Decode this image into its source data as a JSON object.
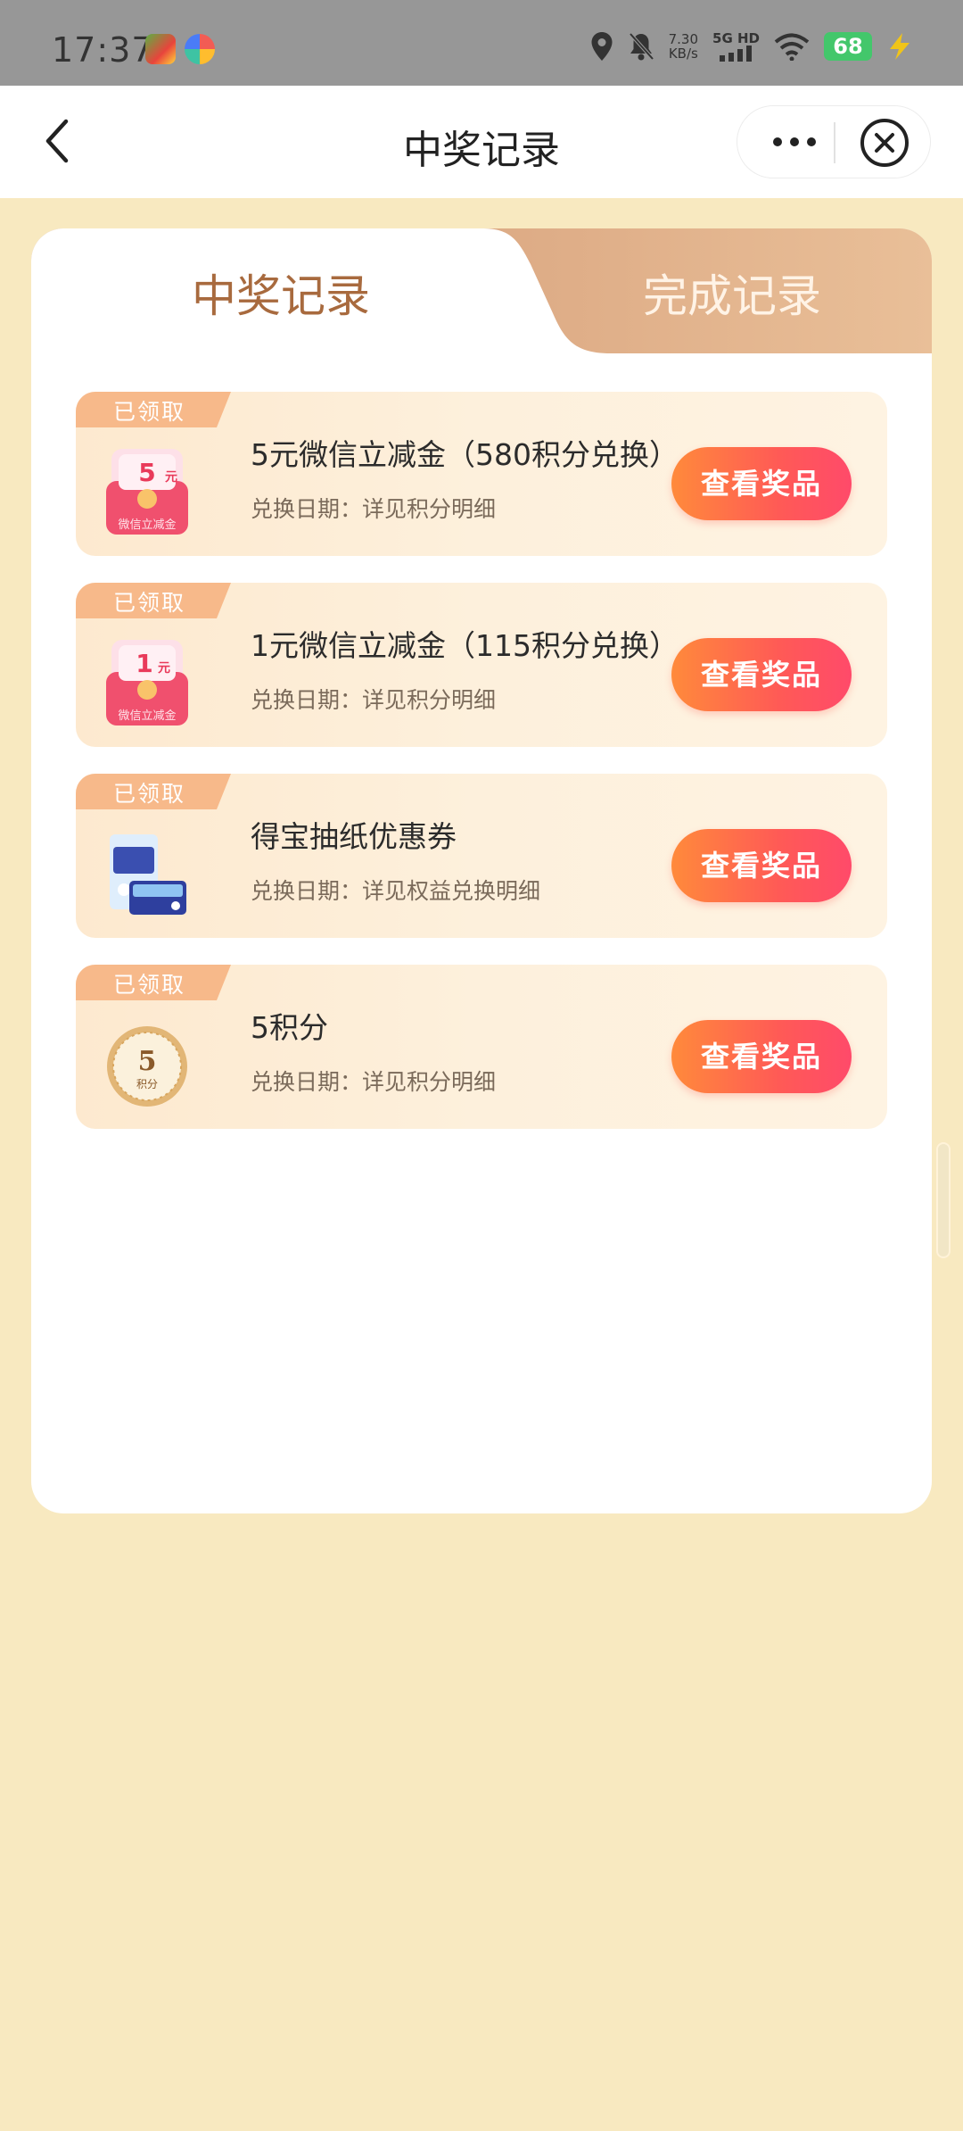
{
  "status_bar": {
    "time": "17:37",
    "speed_value": "7.30",
    "speed_unit": "KB/s",
    "network": "5G HD",
    "battery": "68",
    "icons": [
      "app-icon",
      "app-icon",
      "location-icon",
      "bell-muted-icon",
      "signal-icon",
      "wifi-icon",
      "charging-icon"
    ]
  },
  "nav": {
    "title": "中奖记录",
    "icons": [
      "back-arrow-icon",
      "more-dots-icon",
      "close-circle-icon"
    ]
  },
  "tabs": [
    {
      "label": "中奖记录",
      "active": true
    },
    {
      "label": "完成记录",
      "active": false
    }
  ],
  "prizes": [
    {
      "badge": "已领取",
      "thumb_amount": "5",
      "thumb_unit": "元",
      "thumb_caption": "微信立减金",
      "name": "5元微信立减金（580积分兑换）",
      "date": "兑换日期：详见积分明细",
      "button": "查看奖品"
    },
    {
      "badge": "已领取",
      "thumb_amount": "1",
      "thumb_unit": "元",
      "thumb_caption": "微信立减金",
      "name": "1元微信立减金（115积分兑换）",
      "date": "兑换日期：详见积分明细",
      "button": "查看奖品"
    },
    {
      "badge": "已领取",
      "name": "得宝抽纸优惠券",
      "date": "兑换日期：详见权益兑换明细",
      "button": "查看奖品"
    },
    {
      "badge": "已领取",
      "thumb_amount": "5",
      "thumb_caption": "积分",
      "name": "5积分",
      "date": "兑换日期：详见积分明细",
      "button": "查看奖品"
    }
  ],
  "colors": {
    "page_bg": "#f8e9c0",
    "tab_active": "#a86a3e",
    "button_start": "#ff8a3b",
    "button_end": "#ff4a6a",
    "badge": "#f7b98a"
  }
}
